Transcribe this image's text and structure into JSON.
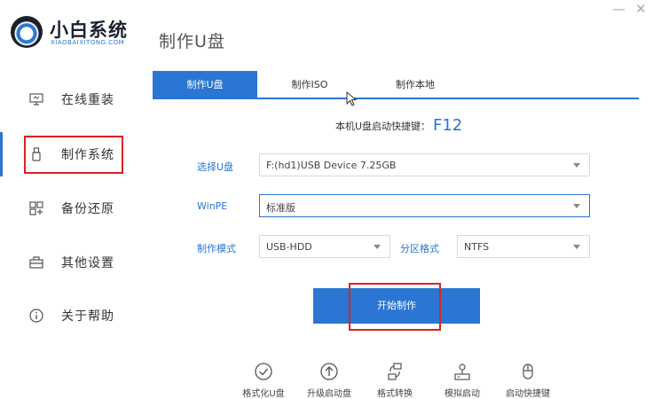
{
  "brand": {
    "name": "小白系统",
    "subtitle": "XIAOBAIXITONG.COM"
  },
  "page_title": "制作U盘",
  "window": {
    "minimize": "—",
    "close": "✕"
  },
  "sidebar": {
    "items": [
      {
        "label": "在线重装",
        "icon": "monitor-icon"
      },
      {
        "label": "制作系统",
        "icon": "usb-icon"
      },
      {
        "label": "备份还原",
        "icon": "grid-icon"
      },
      {
        "label": "其他设置",
        "icon": "briefcase-icon"
      },
      {
        "label": "关于帮助",
        "icon": "info-icon"
      }
    ],
    "active_index": 1
  },
  "tabs": [
    {
      "label": "制作U盘"
    },
    {
      "label": "制作ISO"
    },
    {
      "label": "制作本地"
    }
  ],
  "hotkey": {
    "label": "本机U盘启动快捷键：",
    "value": "F12"
  },
  "form": {
    "usb": {
      "label": "选择U盘",
      "value": "F:(hd1)USB Device 7.25GB"
    },
    "winpe": {
      "label": "WinPE",
      "value": "标准版"
    },
    "mode": {
      "label": "制作模式",
      "value": "USB-HDD"
    },
    "partition": {
      "label": "分区格式",
      "value": "NTFS"
    }
  },
  "start_button": "开始制作",
  "tools": [
    {
      "label": "格式化U盘",
      "icon": "check-circle-icon"
    },
    {
      "label": "升级启动盘",
      "icon": "upload-circle-icon"
    },
    {
      "label": "格式转换",
      "icon": "convert-icon"
    },
    {
      "label": "模拟启动",
      "icon": "simulate-icon"
    },
    {
      "label": "启动快捷键",
      "icon": "mouse-icon"
    }
  ],
  "colors": {
    "accent": "#2a76d2",
    "highlight": "#e02020"
  }
}
